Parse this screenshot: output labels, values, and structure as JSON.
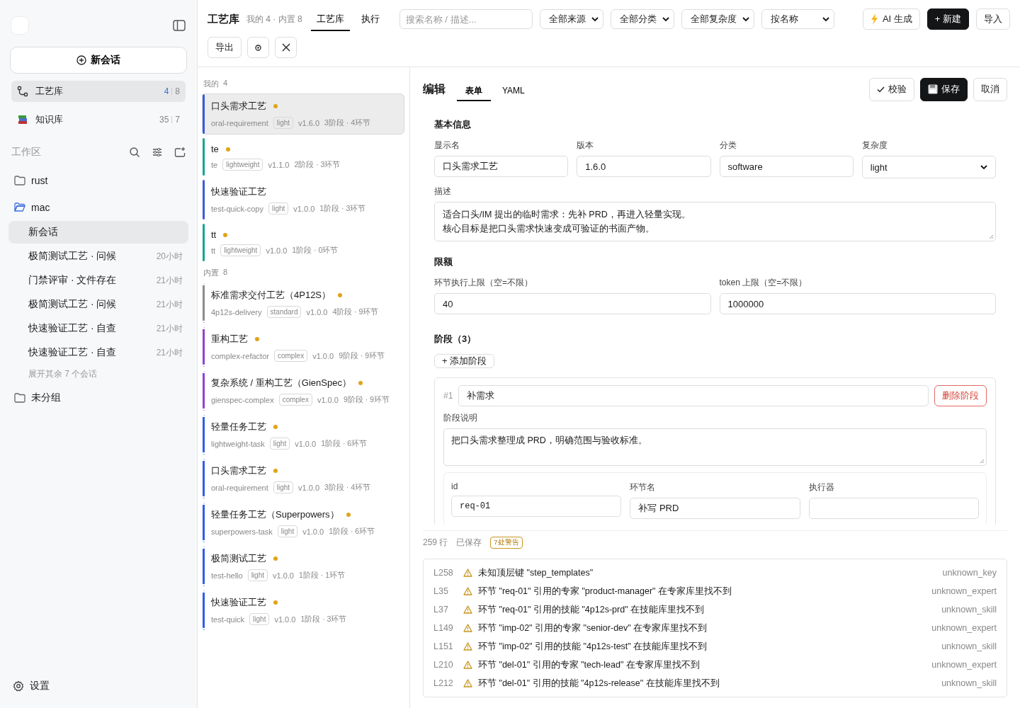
{
  "sidebar": {
    "new_chat": "新会话",
    "nav": [
      {
        "kind": "flow",
        "label": "工艺库",
        "count_a": "4",
        "count_b": "8",
        "selected": true
      },
      {
        "kind": "books",
        "label": "知识库",
        "count_a": "35",
        "count_b": "7",
        "selected": false
      }
    ],
    "workspace_label": "工作区",
    "groups": [
      {
        "name": "rust",
        "expanded": false
      },
      {
        "name": "mac",
        "expanded": true,
        "sessions": [
          {
            "title": "新会话",
            "selected": true
          },
          {
            "title": "极简测试工艺 · 问候",
            "time": "20小时",
            "selected": false
          },
          {
            "title": "门禁评审 · 文件存在",
            "time": "21小时",
            "selected": false
          },
          {
            "title": "极简测试工艺 · 问候",
            "time": "21小时",
            "selected": false
          },
          {
            "title": "快速验证工艺 · 自查",
            "time": "21小时",
            "selected": false
          },
          {
            "title": "快速验证工艺 · 自查",
            "time": "21小时",
            "selected": false
          }
        ],
        "more": "展开其余 7 个会话"
      },
      {
        "name": "未分组",
        "expanded": false
      }
    ],
    "settings": "设置"
  },
  "header": {
    "title": "工艺库",
    "subtitle": "我的 4 · 内置 8",
    "tabs": [
      {
        "label": "工艺库",
        "selected": true
      },
      {
        "label": "执行",
        "selected": false
      }
    ],
    "search": {
      "placeholder": "搜索名称 / 描述..."
    },
    "filters": [
      "全部来源",
      "全部分类",
      "全部复杂度",
      "按名称"
    ],
    "ai_button": "AI 生成",
    "new_button": "+ 新建",
    "import_button": "导入",
    "export_button": "导出"
  },
  "list": {
    "sections": [
      {
        "label": "我的",
        "count": "4",
        "dashed": false,
        "items": [
          {
            "name": "口头需求工艺",
            "dot": true,
            "slug": "oral-requirement",
            "tag": "light",
            "version": "v1.6.0",
            "stats": "3阶段 · 4环节",
            "color": "#3b5bdb",
            "selected": true
          },
          {
            "name": "te",
            "dot": true,
            "slug": "te",
            "tag": "lightweight",
            "version": "v1.1.0",
            "stats": "2阶段 · 3环节",
            "color": "#12a594",
            "selected": false
          },
          {
            "name": "快速验证工艺",
            "dot": false,
            "slug": "test-quick-copy",
            "tag": "light",
            "version": "v1.0.0",
            "stats": "1阶段 · 3环节",
            "color": "#3b5bdb",
            "selected": false
          },
          {
            "name": "tt",
            "dot": true,
            "slug": "tt",
            "tag": "lightweight",
            "version": "v1.0.0",
            "stats": "1阶段 · 0环节",
            "color": "#12a594",
            "selected": false
          }
        ]
      },
      {
        "label": "内置",
        "count": "8",
        "dashed": true,
        "items": [
          {
            "name": "标准需求交付工艺（4P12S）",
            "dot": true,
            "slug": "4p12s-delivery",
            "tag": "standard",
            "version": "v1.0.0",
            "stats": "4阶段 · 9环节",
            "color": "#8c8c8c",
            "selected": false
          },
          {
            "name": "重构工艺",
            "dot": true,
            "slug": "complex-refactor",
            "tag": "complex",
            "version": "v1.0.0",
            "stats": "9阶段 · 9环节",
            "color": "#8e44d6",
            "selected": false
          },
          {
            "name": "复杂系统 / 重构工艺（GienSpec）",
            "dot": true,
            "slug": "gienspec-complex",
            "tag": "complex",
            "version": "v1.0.0",
            "stats": "9阶段 · 9环节",
            "color": "#8e44d6",
            "selected": false
          },
          {
            "name": "轻量任务工艺",
            "dot": true,
            "slug": "lightweight-task",
            "tag": "light",
            "version": "v1.0.0",
            "stats": "1阶段 · 6环节",
            "color": "#2f5de8",
            "selected": false
          },
          {
            "name": "口头需求工艺",
            "dot": true,
            "slug": "oral-requirement",
            "tag": "light",
            "version": "v1.0.0",
            "stats": "3阶段 · 4环节",
            "color": "#2f5de8",
            "selected": false
          },
          {
            "name": "轻量任务工艺（Superpowers）",
            "dot": true,
            "slug": "superpowers-task",
            "tag": "light",
            "version": "v1.0.0",
            "stats": "1阶段 · 6环节",
            "color": "#2f5de8",
            "selected": false
          },
          {
            "name": "极简测试工艺",
            "dot": true,
            "slug": "test-hello",
            "tag": "light",
            "version": "v1.0.0",
            "stats": "1阶段 · 1环节",
            "color": "#2f5de8",
            "selected": false
          },
          {
            "name": "快速验证工艺",
            "dot": true,
            "slug": "test-quick",
            "tag": "light",
            "version": "v1.0.0",
            "stats": "1阶段 · 3环节",
            "color": "#2f5de8",
            "selected": false
          }
        ]
      }
    ]
  },
  "editor": {
    "title": "编辑",
    "tabs": [
      {
        "label": "表单",
        "selected": true
      },
      {
        "label": "YAML",
        "selected": false
      }
    ],
    "validate_button": "校验",
    "save_button": "保存",
    "cancel_button": "取消",
    "basic": {
      "title": "基本信息",
      "fields": [
        {
          "kind": "input",
          "label": "显示名",
          "value": "口头需求工艺"
        },
        {
          "kind": "input",
          "label": "版本",
          "value": "1.6.0"
        },
        {
          "kind": "input",
          "label": "分类",
          "value": "software"
        },
        {
          "kind": "select",
          "label": "复杂度",
          "value": "light"
        }
      ],
      "description_label": "描述",
      "description": [
        "适合口头/IM 提出的临时需求：先补 PRD，再进入轻量实现。",
        "核心目标是把口头需求快速变成可验证的书面产物。"
      ]
    },
    "limits": {
      "title": "限额",
      "fields": [
        {
          "label": "环节执行上限（空=不限）",
          "value": "40"
        },
        {
          "label": "token 上限（空=不限）",
          "value": "1000000"
        }
      ]
    },
    "stages": {
      "title": "阶段（3）",
      "add_button": "+ 添加阶段",
      "stage": {
        "number": "#1",
        "name": "补需求",
        "delete_button": "删除阶段",
        "description_label": "阶段说明",
        "description": "把口头需求整理成 PRD，明确范围与验收标准。",
        "step_fields": [
          {
            "kind": "code",
            "label": "id",
            "value": "req-01"
          },
          {
            "kind": "input",
            "label": "环节名",
            "value": "补写 PRD"
          },
          {
            "kind": "input",
            "label": "执行器"
          }
        ]
      }
    }
  },
  "status": {
    "lines": "259 行",
    "saved": "已保存",
    "warnings_badge": "7处警告"
  },
  "warnings": [
    {
      "line": "L258",
      "text": "未知顶层键 \"step_templates\"",
      "code": "unknown_key"
    },
    {
      "line": "L35",
      "text": "环节 \"req-01\" 引用的专家 \"product-manager\" 在专家库里找不到",
      "code": "unknown_expert"
    },
    {
      "line": "L37",
      "text": "环节 \"req-01\" 引用的技能 \"4p12s-prd\" 在技能库里找不到",
      "code": "unknown_skill"
    },
    {
      "line": "L149",
      "text": "环节 \"imp-02\" 引用的专家 \"senior-dev\" 在专家库里找不到",
      "code": "unknown_expert"
    },
    {
      "line": "L151",
      "text": "环节 \"imp-02\" 引用的技能 \"4p12s-test\" 在技能库里找不到",
      "code": "unknown_skill"
    },
    {
      "line": "L210",
      "text": "环节 \"del-01\" 引用的专家 \"tech-lead\" 在专家库里找不到",
      "code": "unknown_expert"
    },
    {
      "line": "L212",
      "text": "环节 \"del-01\" 引用的技能 \"4p12s-release\" 在技能库里找不到",
      "code": "unknown_skill"
    }
  ]
}
